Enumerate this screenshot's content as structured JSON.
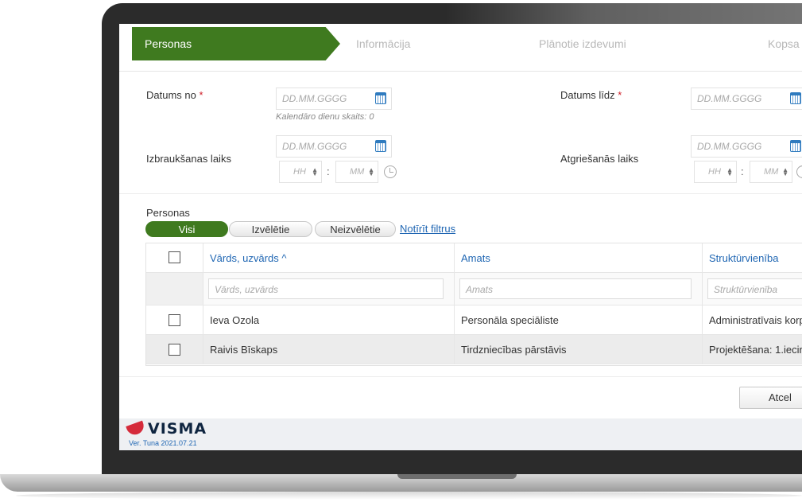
{
  "wizard": {
    "steps": [
      {
        "label": "Personas",
        "active": true
      },
      {
        "label": "Informācija",
        "active": false
      },
      {
        "label": "Plānotie izdevumi",
        "active": false
      },
      {
        "label": "Kopsa",
        "active": false
      }
    ]
  },
  "form": {
    "date_from": {
      "label": "Datums no",
      "required_mark": "*",
      "placeholder": "DD.MM.GGGG",
      "hint": "Kalendāro dienu skaits: 0"
    },
    "date_to": {
      "label": "Datums līdz",
      "required_mark": "*",
      "placeholder": "DD.MM.GGGG"
    },
    "departure": {
      "label": "Izbraukšanas laiks",
      "date_placeholder": "DD.MM.GGGG",
      "hour_placeholder": "HH",
      "minute_placeholder": "MM",
      "separator": ":"
    },
    "return": {
      "label": "Atgriešanās laiks",
      "date_placeholder": "DD.MM.GGGG",
      "hour_placeholder": "HH",
      "minute_placeholder": "MM",
      "separator": ":"
    }
  },
  "persons": {
    "section_label": "Personas",
    "filters": [
      {
        "label": "Visi",
        "active": true
      },
      {
        "label": "Izvēlētie",
        "active": false
      },
      {
        "label": "Neizvēlētie",
        "active": false
      }
    ],
    "clear_filters": "Notīrīt filtrus",
    "columns": [
      {
        "label": "Vārds, uzvārds ^",
        "filter_placeholder": "Vārds, uzvārds"
      },
      {
        "label": "Amats",
        "filter_placeholder": "Amats"
      },
      {
        "label": "Struktūrvienība",
        "filter_placeholder": "Struktūrvienība"
      }
    ],
    "rows": [
      {
        "name": "Ieva Ozola",
        "position": "Personāla speciāliste",
        "unit": "Administratīvais korp",
        "checked": false
      },
      {
        "name": "Raivis Bīskaps",
        "position": "Tirdzniecības pārstāvis",
        "unit": "Projektēšana: 1.iecirk",
        "checked": false
      }
    ]
  },
  "footer": {
    "cancel_label": "Atcel",
    "brand": "VISMA",
    "version": "Ver. Tuna 2021.07.21"
  },
  "colors": {
    "accent_green": "#3f7a1f",
    "link_blue": "#1f66b3",
    "required_red": "#d0202a",
    "brand_red": "#d52b3b"
  }
}
